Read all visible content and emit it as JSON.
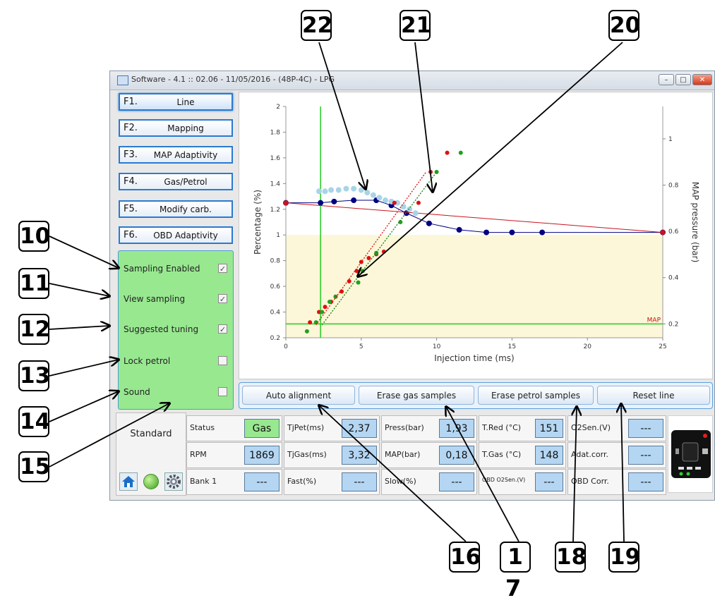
{
  "window": {
    "title": "Software - 4.1 :: 02.06 - 11/05/2016 - (48P-4C) - LPG",
    "controls": [
      "–",
      "□",
      "✕"
    ]
  },
  "function_buttons": [
    {
      "key": "F1.",
      "label": "Line",
      "active": true
    },
    {
      "key": "F2.",
      "label": "Mapping",
      "active": false
    },
    {
      "key": "F3.",
      "label": "MAP Adaptivity",
      "active": false
    },
    {
      "key": "F4.",
      "label": "Gas/Petrol",
      "active": false
    },
    {
      "key": "F5.",
      "label": "Modify carb.",
      "active": false
    },
    {
      "key": "F6.",
      "label": "OBD Adaptivity",
      "active": false
    }
  ],
  "options": [
    {
      "label": "Sampling Enabled",
      "checked": true
    },
    {
      "label": "View sampling",
      "checked": true
    },
    {
      "label": "Suggested tuning",
      "checked": true
    },
    {
      "label": "Lock petrol",
      "checked": false
    },
    {
      "label": "Sound",
      "checked": false
    }
  ],
  "check_mark": "✓",
  "actions": [
    "Auto alignment",
    "Erase gas samples",
    "Erase petrol samples",
    "Reset line"
  ],
  "mode": "Standard",
  "status_cells": [
    [
      {
        "label": "Status",
        "value": "Gas"
      },
      {
        "label": "TjPet(ms)",
        "value": "2,37"
      },
      {
        "label": "Press(bar)",
        "value": "1,93"
      },
      {
        "label": "T.Red (°C)",
        "value": "151"
      },
      {
        "label": "O2Sen.(V)",
        "value": "---"
      }
    ],
    [
      {
        "label": "RPM",
        "value": "1869"
      },
      {
        "label": "TjGas(ms)",
        "value": "3,32"
      },
      {
        "label": "MAP(bar)",
        "value": "0,18"
      },
      {
        "label": "T.Gas (°C)",
        "value": "148"
      },
      {
        "label": "Adat.corr.",
        "value": "---"
      }
    ],
    [
      {
        "label": "Bank 1",
        "value": "---"
      },
      {
        "label": "Fast(%)",
        "value": "---"
      },
      {
        "label": "Slow(%)",
        "value": "---"
      },
      {
        "label": "OBD O2Sen.(V)",
        "value": "---"
      },
      {
        "label": "OBD Corr.",
        "value": "---"
      }
    ]
  ],
  "colors": {
    "status_gas": "#98e890",
    "value_box": "#b4d6f2",
    "accent": "#2a7ad0",
    "panel_green": "#98e890"
  },
  "icons": [
    "home-icon",
    "led-indicator-icon",
    "settings-gear-icon",
    "ecu-connection-icon"
  ],
  "callouts": [
    "22",
    "21",
    "20",
    "10",
    "11",
    "12",
    "13",
    "14",
    "15",
    "16",
    "1",
    "7",
    "18",
    "19"
  ],
  "chart_data": {
    "type": "scatter",
    "xlabel": "Injection time (ms)",
    "ylabel": "Percentage (%)",
    "y2label": "MAP pressure (bar)",
    "xlim": [
      0,
      25
    ],
    "ylim": [
      0.2,
      2
    ],
    "y2lim": [
      0.14,
      1.14
    ],
    "xticks": [
      "0",
      "5",
      "10",
      "15",
      "20",
      "25"
    ],
    "yticks": [
      "0.2",
      "0.4",
      "0.6",
      "0.8",
      "1",
      "1.2",
      "1.4",
      "1.6",
      "1.8",
      "2"
    ],
    "y2ticks": [
      "0.2",
      "0.4",
      "0.6",
      "0.8",
      "1"
    ],
    "shaded_region": {
      "y_from": 0.2,
      "y_to": 1.0,
      "color": "#fbf7d8"
    },
    "map_line_label": "MAP",
    "map_line_y2": 0.2,
    "cursor_x": 2.3,
    "series": [
      {
        "color": "#000080",
        "style": "line-markers",
        "x": [
          0,
          2.3,
          3.2,
          4.5,
          6.0,
          7.0,
          8.0,
          9.5,
          11.5,
          13.3,
          15.0,
          17.0,
          25.0
        ],
        "y": [
          1.25,
          1.25,
          1.26,
          1.27,
          1.27,
          1.23,
          1.17,
          1.09,
          1.04,
          1.02,
          1.02,
          1.02,
          1.02
        ]
      },
      {
        "color": "#c8141e",
        "style": "line-markers",
        "x": [
          0,
          25
        ],
        "y": [
          1.25,
          1.02
        ]
      },
      {
        "color": "#a8d4e6",
        "style": "markers",
        "x": [
          2.2,
          2.6,
          3.0,
          3.5,
          4.0,
          4.5,
          5.0,
          5.4,
          5.8,
          6.2,
          6.6,
          7.0,
          7.4,
          7.8,
          8.2,
          8.6
        ],
        "y": [
          1.34,
          1.34,
          1.35,
          1.35,
          1.36,
          1.36,
          1.35,
          1.33,
          1.31,
          1.29,
          1.27,
          1.26,
          1.25,
          1.22,
          1.2,
          1.17
        ]
      },
      {
        "color": "#e01010",
        "style": "markers",
        "x": [
          1.6,
          2.2,
          2.6,
          3.0,
          3.3,
          3.7,
          4.2,
          4.7,
          5.0,
          5.5,
          6.0,
          6.5,
          7.2,
          8.8,
          9.6,
          10.7
        ],
        "y": [
          0.32,
          0.4,
          0.44,
          0.48,
          0.52,
          0.56,
          0.64,
          0.72,
          0.79,
          0.82,
          0.85,
          0.87,
          1.25,
          1.25,
          1.49,
          1.64
        ]
      },
      {
        "color": "#20a020",
        "style": "markers",
        "x": [
          1.4,
          2.0,
          2.4,
          2.9,
          3.3,
          4.8,
          5.1,
          6.0,
          7.6,
          10.0,
          11.6
        ],
        "y": [
          0.25,
          0.32,
          0.4,
          0.48,
          0.52,
          0.63,
          0.72,
          0.86,
          1.1,
          1.49,
          1.64
        ]
      },
      {
        "color": "#e01010",
        "style": "dotted-fit",
        "x": [
          2.0,
          9.3
        ],
        "y": [
          0.3,
          1.49
        ]
      },
      {
        "color": "#108010",
        "style": "dotted-fit",
        "x": [
          2.4,
          10.0
        ],
        "y": [
          0.3,
          1.49
        ]
      }
    ]
  }
}
